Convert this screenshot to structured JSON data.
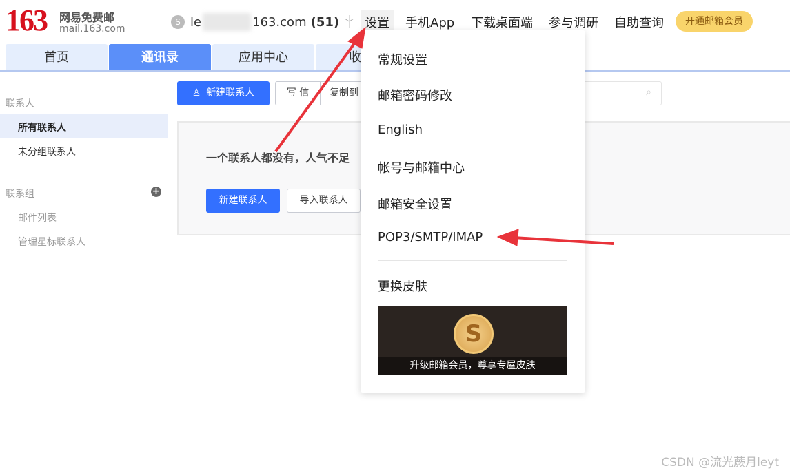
{
  "header": {
    "logo_number": "163",
    "logo_name": "网易免费邮",
    "logo_url": "mail.163.com",
    "account_prefix": "le",
    "account_suffix": "163.com",
    "unread_count": "(51)",
    "nav": [
      "设置",
      "手机App",
      "下载桌面端",
      "参与调研",
      "自助查询"
    ],
    "vip_button": "开通邮箱会员"
  },
  "tabs": [
    {
      "label": "首页"
    },
    {
      "label": "通讯录",
      "active": true
    },
    {
      "label": "应用中心"
    },
    {
      "label": "收"
    }
  ],
  "sidebar": {
    "contacts_header": "联系人",
    "items": [
      "所有联系人",
      "未分组联系人"
    ],
    "groups_header": "联系组",
    "group_items": [
      "邮件列表",
      "管理星标联系人"
    ]
  },
  "toolbar": {
    "new_contact": "新建联系人",
    "write": "写 信",
    "copy_to": "复制到"
  },
  "empty_state": {
    "message": "一个联系人都没有，人气不足",
    "new_contact": "新建联系人",
    "import_contact": "导入联系人"
  },
  "settings_menu": {
    "items": [
      "常规设置",
      "邮箱密码修改",
      "English",
      "帐号与邮箱中心",
      "邮箱安全设置",
      "POP3/SMTP/IMAP"
    ],
    "skin": "更换皮肤",
    "banner_text": "升级邮箱会员，尊享专屋皮肤"
  },
  "watermark": "CSDN @流光蕨月leyt",
  "colors": {
    "brand_red": "#d7111e",
    "primary": "#3370ff",
    "tab_active": "#5b8ff9",
    "annotation_arrow": "#e8333a"
  }
}
